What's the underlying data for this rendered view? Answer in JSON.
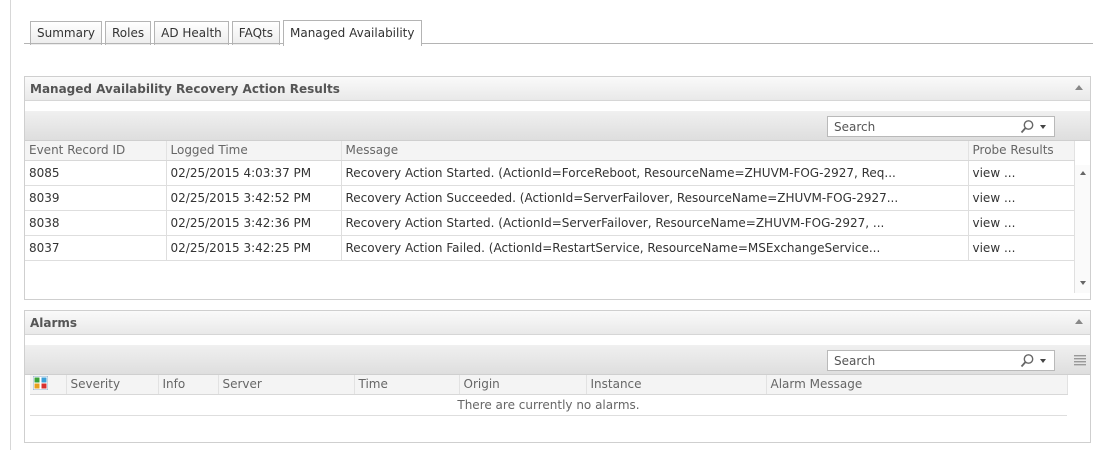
{
  "tabs": [
    {
      "label": "Summary"
    },
    {
      "label": "Roles"
    },
    {
      "label": "AD Health"
    },
    {
      "label": "FAQts"
    },
    {
      "label": "Managed Availability"
    }
  ],
  "active_tab": "Managed Availability",
  "recovery_panel": {
    "title": "Managed Availability Recovery Action Results",
    "search_placeholder": "Search",
    "columns": [
      "Event Record ID",
      "Logged Time",
      "Message",
      "Probe Results"
    ],
    "rows": [
      {
        "id": "8085",
        "time": "02/25/2015 4:03:37 PM",
        "message": "Recovery Action Started. (ActionId=ForceReboot, ResourceName=ZHUVM-FOG-2927, Req...",
        "probe": "view ..."
      },
      {
        "id": "8039",
        "time": "02/25/2015 3:42:52 PM",
        "message": "Recovery Action Succeeded. (ActionId=ServerFailover, ResourceName=ZHUVM-FOG-2927...",
        "probe": "view ..."
      },
      {
        "id": "8038",
        "time": "02/25/2015 3:42:36 PM",
        "message": "Recovery Action Started. (ActionId=ServerFailover, ResourceName=ZHUVM-FOG-2927, ...",
        "probe": "view ..."
      },
      {
        "id": "8037",
        "time": "02/25/2015 3:42:25 PM",
        "message": "Recovery Action Failed. (ActionId=RestartService, ResourceName=MSExchangeService...",
        "probe": "view ..."
      }
    ]
  },
  "alarms_panel": {
    "title": "Alarms",
    "search_placeholder": "Search",
    "columns": [
      "Severity",
      "Info",
      "Server",
      "Time",
      "Origin",
      "Instance",
      "Alarm Message"
    ],
    "empty_message": "There are currently no alarms."
  }
}
